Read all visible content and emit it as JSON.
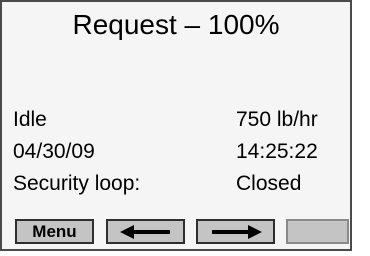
{
  "header": {
    "title": "Request – 100%"
  },
  "status": {
    "state": "Idle",
    "rate": "750 lb/hr",
    "date": "04/30/09",
    "time": "14:25:22",
    "security_label": "Security loop:",
    "security_value": "Closed"
  },
  "softkeys": {
    "menu_label": "Menu",
    "left_icon": "arrow-left-icon",
    "right_icon": "arrow-right-icon"
  }
}
